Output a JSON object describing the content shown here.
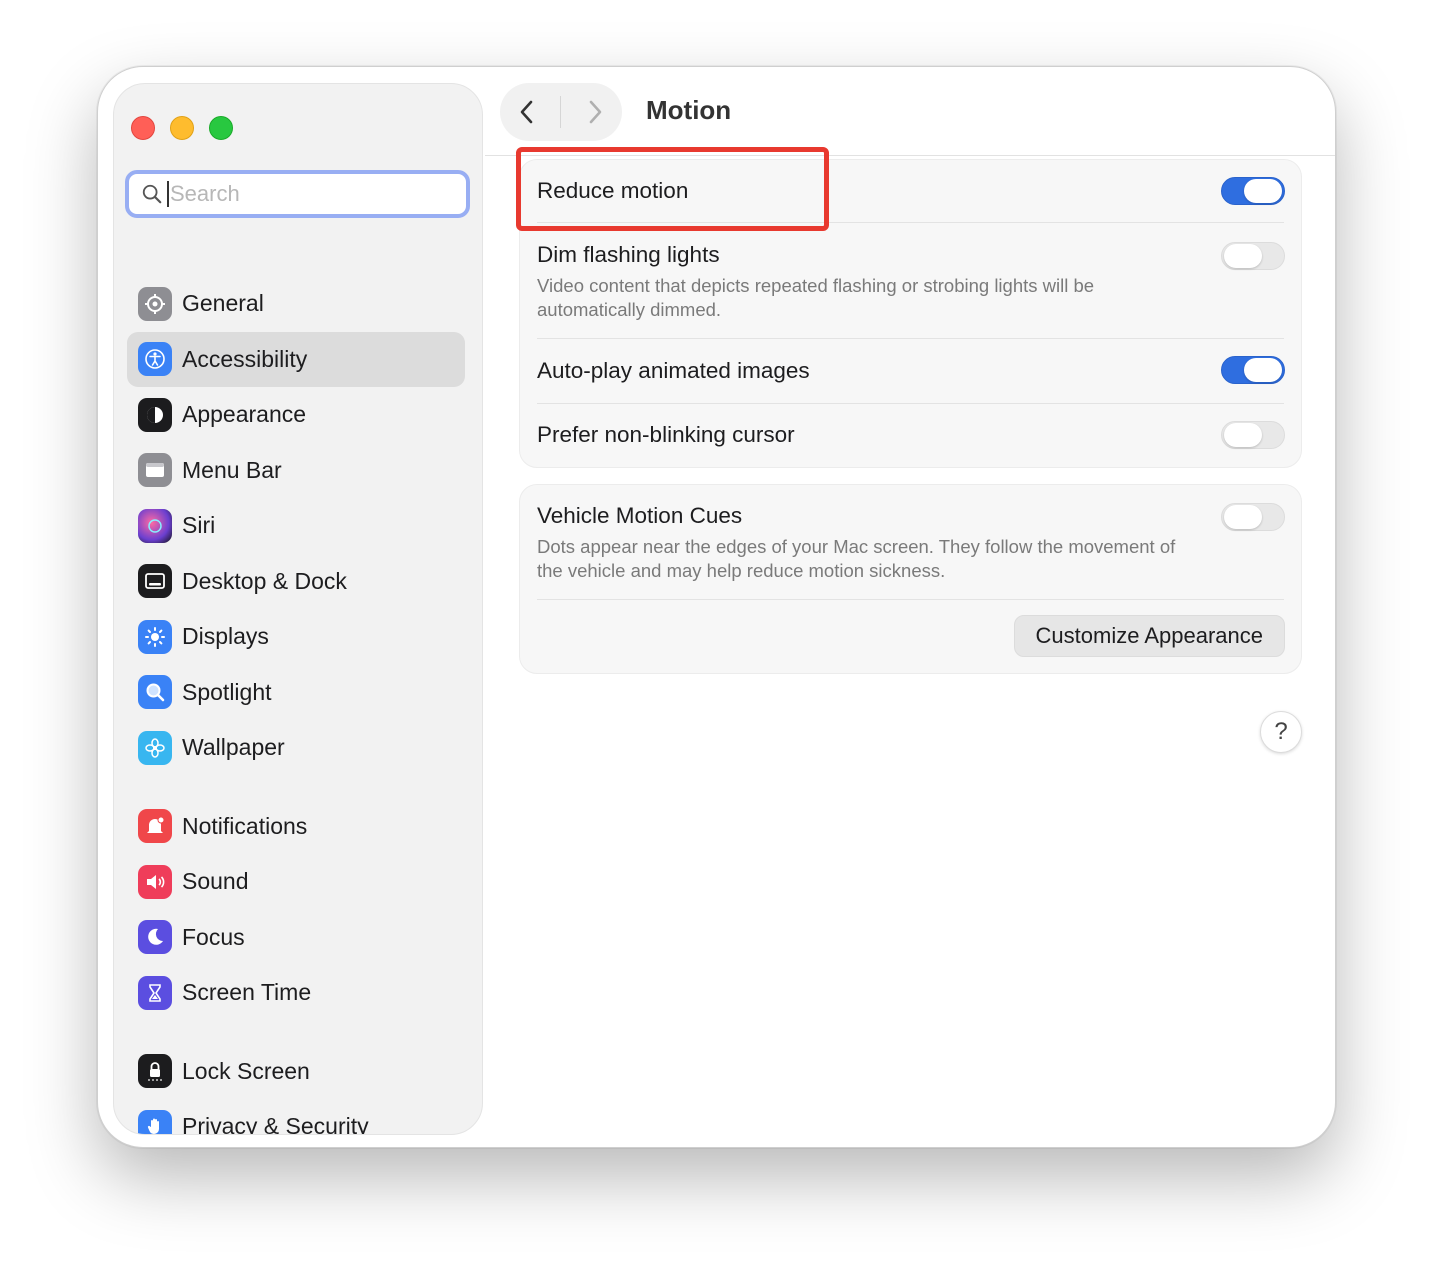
{
  "window": {
    "title": "Motion"
  },
  "search": {
    "placeholder": "Search",
    "value": ""
  },
  "sidebar": {
    "items": [
      {
        "label": "General",
        "icon": "gear-icon",
        "color": "#8e8e93",
        "selected": false
      },
      {
        "label": "Accessibility",
        "icon": "accessibility-icon",
        "color": "#3a82f6",
        "selected": true
      },
      {
        "label": "Appearance",
        "icon": "appearance-icon",
        "color": "#1c1c1e",
        "selected": false
      },
      {
        "label": "Menu Bar",
        "icon": "menubar-icon",
        "color": "#8e8e93",
        "selected": false
      },
      {
        "label": "Siri",
        "icon": "siri-icon",
        "color": "#6b3fd0",
        "selected": false
      },
      {
        "label": "Desktop & Dock",
        "icon": "dock-icon",
        "color": "#1c1c1e",
        "selected": false
      },
      {
        "label": "Displays",
        "icon": "sun-icon",
        "color": "#3a82f6",
        "selected": false
      },
      {
        "label": "Spotlight",
        "icon": "magnifier-icon",
        "color": "#3a82f6",
        "selected": false
      },
      {
        "label": "Wallpaper",
        "icon": "flower-icon",
        "color": "#38b6f0",
        "selected": false
      },
      {
        "label": "Notifications",
        "icon": "bell-icon",
        "color": "#f0474a",
        "selected": false
      },
      {
        "label": "Sound",
        "icon": "speaker-icon",
        "color": "#ef3d5a",
        "selected": false
      },
      {
        "label": "Focus",
        "icon": "moon-icon",
        "color": "#5b4ee0",
        "selected": false
      },
      {
        "label": "Screen Time",
        "icon": "hourglass-icon",
        "color": "#5b4ee0",
        "selected": false
      },
      {
        "label": "Lock Screen",
        "icon": "lock-icon",
        "color": "#1c1c1e",
        "selected": false
      },
      {
        "label": "Privacy & Security",
        "icon": "hand-icon",
        "color": "#3a82f6",
        "selected": false
      }
    ]
  },
  "main": {
    "title": "Motion",
    "group1": [
      {
        "title": "Reduce motion",
        "desc": "",
        "on": true
      },
      {
        "title": "Dim flashing lights",
        "desc": "Video content that depicts repeated flashing or strobing lights will be automatically dimmed.",
        "on": false
      },
      {
        "title": "Auto-play animated images",
        "desc": "",
        "on": true
      },
      {
        "title": "Prefer non-blinking cursor",
        "desc": "",
        "on": false
      }
    ],
    "group2": {
      "title": "Vehicle Motion Cues",
      "desc": "Dots appear near the edges of your Mac screen. They follow the movement of the vehicle and may help reduce motion sickness.",
      "on": false,
      "button_label": "Customize Appearance"
    },
    "help_label": "?"
  },
  "colors": {
    "accent": "#2f6ee0",
    "highlight": "#e8392f"
  }
}
